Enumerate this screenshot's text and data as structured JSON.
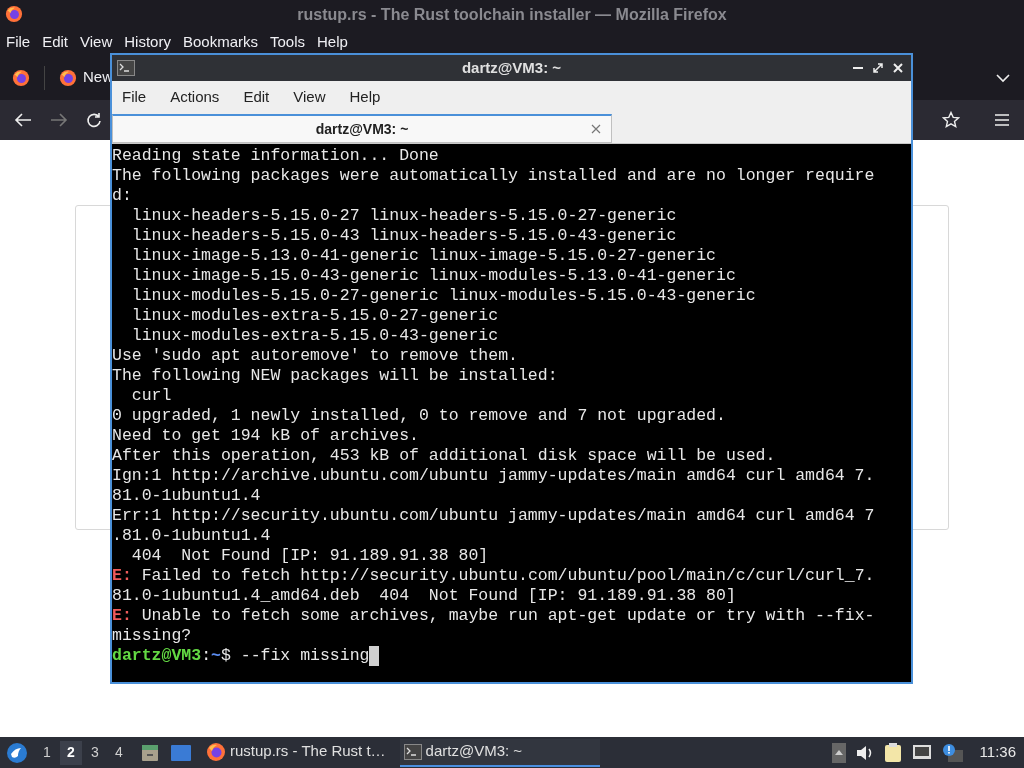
{
  "browser": {
    "title": "rustup.rs - The Rust toolchain installer — Mozilla Firefox",
    "menu": [
      "File",
      "Edit",
      "View",
      "History",
      "Bookmarks",
      "Tools",
      "Help"
    ],
    "tab": {
      "label": "New"
    }
  },
  "terminal": {
    "title": "dartz@VM3: ~",
    "menu": [
      "File",
      "Actions",
      "Edit",
      "View",
      "Help"
    ],
    "tabs": [
      {
        "label": "dartz@VM3: ~",
        "selected": true
      }
    ],
    "lines": [
      {
        "kind": "plain",
        "text": "Reading state information... Done"
      },
      {
        "kind": "plain",
        "text": "The following packages were automatically installed and are no longer require"
      },
      {
        "kind": "plain",
        "text": "d:"
      },
      {
        "kind": "plain",
        "text": "  linux-headers-5.15.0-27 linux-headers-5.15.0-27-generic"
      },
      {
        "kind": "plain",
        "text": "  linux-headers-5.15.0-43 linux-headers-5.15.0-43-generic"
      },
      {
        "kind": "plain",
        "text": "  linux-image-5.13.0-41-generic linux-image-5.15.0-27-generic"
      },
      {
        "kind": "plain",
        "text": "  linux-image-5.15.0-43-generic linux-modules-5.13.0-41-generic"
      },
      {
        "kind": "plain",
        "text": "  linux-modules-5.15.0-27-generic linux-modules-5.15.0-43-generic"
      },
      {
        "kind": "plain",
        "text": "  linux-modules-extra-5.15.0-27-generic"
      },
      {
        "kind": "plain",
        "text": "  linux-modules-extra-5.15.0-43-generic"
      },
      {
        "kind": "plain",
        "text": "Use 'sudo apt autoremove' to remove them."
      },
      {
        "kind": "plain",
        "text": "The following NEW packages will be installed:"
      },
      {
        "kind": "plain",
        "text": "  curl"
      },
      {
        "kind": "plain",
        "text": "0 upgraded, 1 newly installed, 0 to remove and 7 not upgraded."
      },
      {
        "kind": "plain",
        "text": "Need to get 194 kB of archives."
      },
      {
        "kind": "plain",
        "text": "After this operation, 453 kB of additional disk space will be used."
      },
      {
        "kind": "plain",
        "text": "Ign:1 http://archive.ubuntu.com/ubuntu jammy-updates/main amd64 curl amd64 7."
      },
      {
        "kind": "plain",
        "text": "81.0-1ubuntu1.4"
      },
      {
        "kind": "plain",
        "text": "Err:1 http://security.ubuntu.com/ubuntu jammy-updates/main amd64 curl amd64 7"
      },
      {
        "kind": "plain",
        "text": ".81.0-1ubuntu1.4"
      },
      {
        "kind": "plain",
        "text": "  404  Not Found [IP: 91.189.91.38 80]"
      },
      {
        "kind": "error",
        "prefix": "E:",
        "text": " Failed to fetch http://security.ubuntu.com/ubuntu/pool/main/c/curl/curl_7."
      },
      {
        "kind": "plain",
        "text": "81.0-1ubuntu1.4_amd64.deb  404  Not Found [IP: 91.189.91.38 80]"
      },
      {
        "kind": "error",
        "prefix": "E:",
        "text": " Unable to fetch some archives, maybe run apt-get update or try with --fix-"
      },
      {
        "kind": "plain",
        "text": "missing?"
      },
      {
        "kind": "prompt",
        "user": "dartz@VM3",
        "sep": ":",
        "path": "~",
        "text": "$ --fix missing"
      }
    ]
  },
  "taskbar": {
    "workspaces": [
      {
        "label": "1",
        "selected": false
      },
      {
        "label": "2",
        "selected": true
      },
      {
        "label": "3",
        "selected": false
      },
      {
        "label": "4",
        "selected": false
      }
    ],
    "tasks": [
      {
        "kind": "firefox",
        "label": "rustup.rs - The Rust t…",
        "selected": false
      },
      {
        "kind": "terminal",
        "label": "dartz@VM3: ~",
        "selected": true
      }
    ],
    "clock": "11:36"
  }
}
